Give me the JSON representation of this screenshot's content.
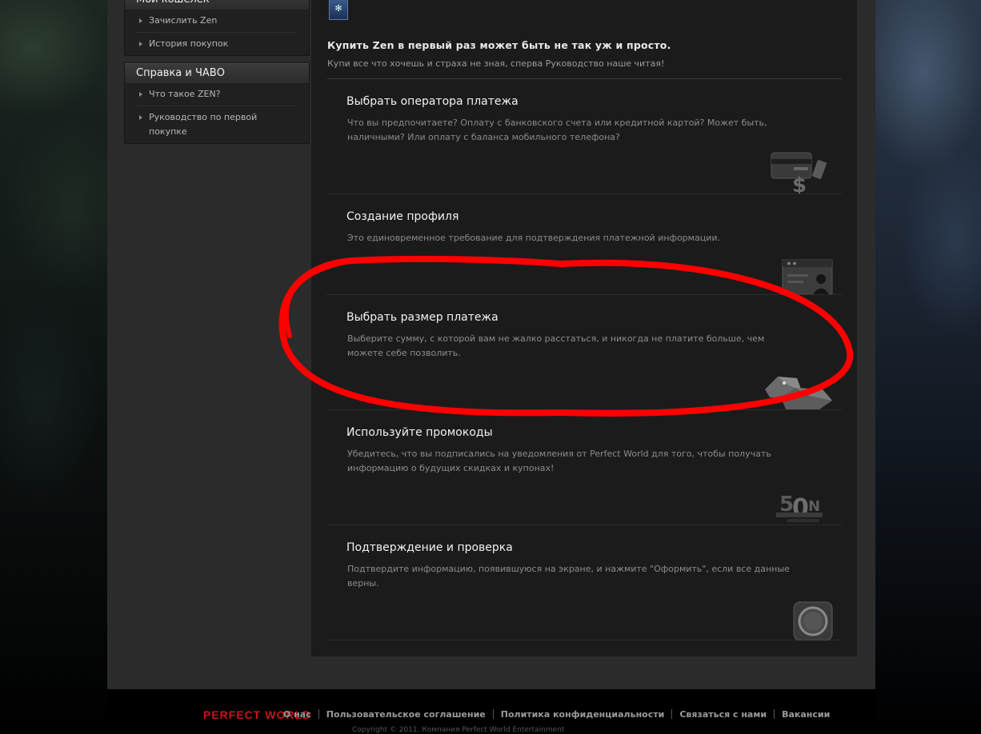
{
  "sidebar": {
    "wallet": {
      "title": "Мой кошелек",
      "items": [
        "Зачислить Zen",
        "История покупок"
      ]
    },
    "help": {
      "title": "Справка и ЧАВО",
      "items": [
        "Что такое ZEN?",
        "Руководство по первой покупке"
      ]
    }
  },
  "main": {
    "intro_title": "Купить Zen в первый раз может быть не так уж и просто.",
    "intro_subtitle": "Купи все что хочешь и страха не зная, сперва Руководство наше читая!",
    "steps": [
      {
        "title": "Выбрать оператора платежа",
        "description": "Что вы предпочитаете? Оплату с банковского счета или кредитной картой? Может быть, наличными? Или оплату с баланса мобильного телефона?",
        "icon": "payment-card-phone-icon"
      },
      {
        "title": "Создание профиля",
        "description": "Это единовременное требование для подтверждения платежной информации.",
        "icon": "profile-window-icon"
      },
      {
        "title": "Выбрать размер платежа",
        "description": "Выберите сумму, с которой вам не жалко расстаться, и никогда не платите больше, чем можете себе позволить.",
        "icon": "zen-stones-icon"
      },
      {
        "title": "Используйте промокоды",
        "description": "Убедитесь, что вы подписались на уведомления от Perfect World для того, чтобы получать информацию о будущих скидках и купонах!",
        "icon": "discount-icon"
      },
      {
        "title": "Подтверждение и проверка",
        "description": "Подтвердите информацию, появившуюся на экране, и нажмите \"Оформить\", если все данные верны.",
        "icon": "confirm-icon"
      }
    ]
  },
  "footer": {
    "logo": "PERFECT WORLD",
    "links": [
      "О нас",
      "Пользовательское соглашение",
      "Политика конфиденциальности",
      "Связаться с нами",
      "Вакансии"
    ],
    "copyright": "Copyright © 2011, Компания Perfect World Entertainment"
  },
  "colors": {
    "annotation": "#ff0000",
    "logo": "#c4161c"
  }
}
